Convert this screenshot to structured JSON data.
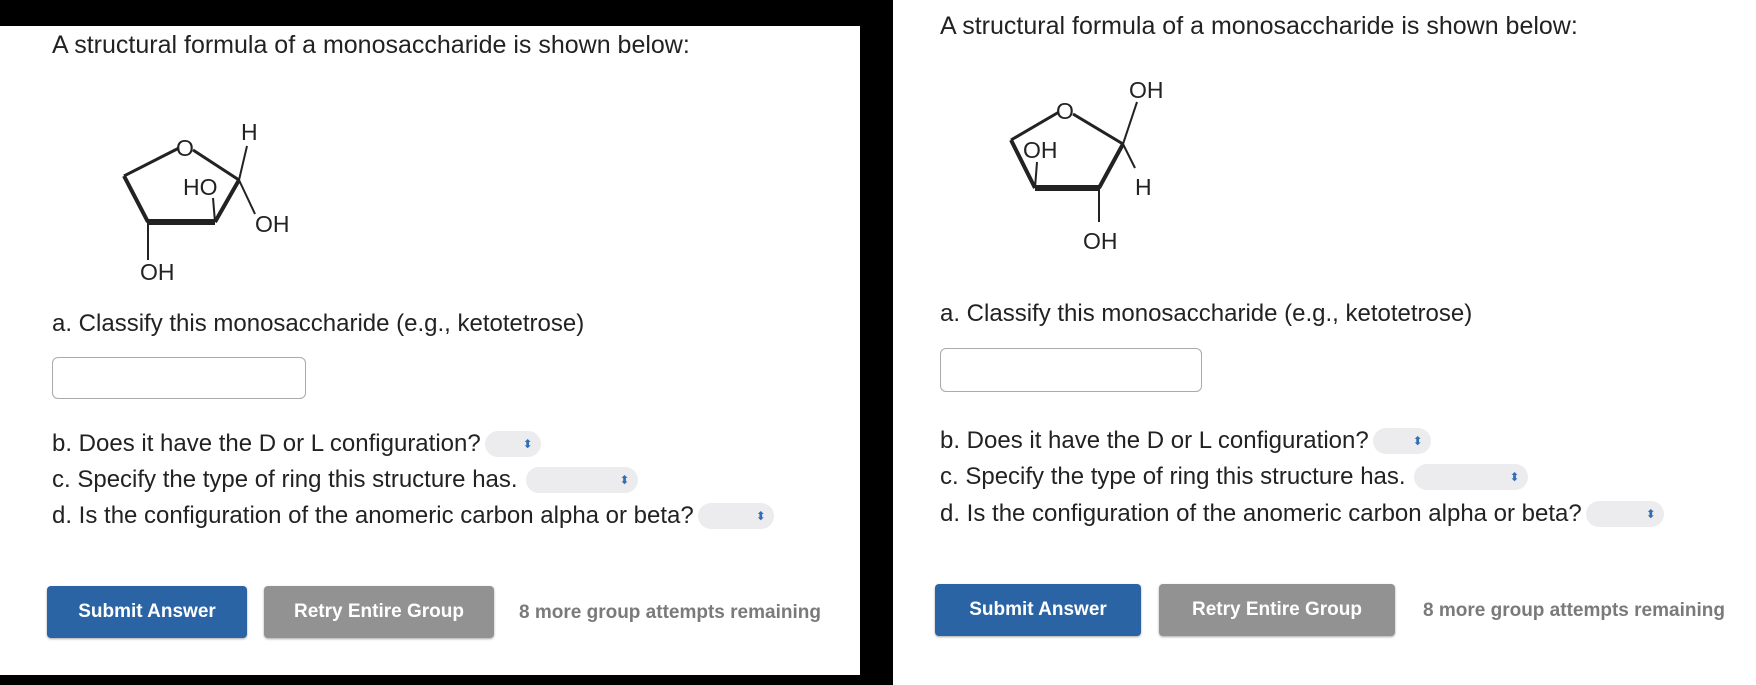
{
  "left_panel": {
    "prompt": "A structural formula of a monosaccharide is shown below:",
    "structure": {
      "labels": {
        "ring_o": "O",
        "top_h": "H",
        "ring_ho": "HO",
        "right_oh": "OH",
        "bottom_oh": "OH"
      }
    },
    "question_a": "a. Classify this monosaccharide (e.g., ketotetrose)",
    "answer_a_value": "",
    "question_b": "b. Does it have the D or L configuration?",
    "question_c": "c. Specify the type of ring this structure has.",
    "question_d": "d. Is the configuration of the anomeric carbon alpha or beta?",
    "select_b_value": "",
    "select_c_value": "",
    "select_d_value": "",
    "submit_label": "Submit Answer",
    "retry_label": "Retry Entire Group",
    "attempts_text": "8 more group attempts remaining"
  },
  "right_panel": {
    "prompt": "A structural formula of a monosaccharide is shown below:",
    "structure": {
      "labels": {
        "ring_o": "O",
        "top_oh": "OH",
        "ring_oh": "OH",
        "right_h": "H",
        "bottom_oh": "OH"
      }
    },
    "question_a": "a. Classify this monosaccharide (e.g., ketotetrose)",
    "answer_a_value": "",
    "question_b": "b. Does it have the D or L configuration?",
    "question_c": "c. Specify the type of ring this structure has.",
    "question_d": "d. Is the configuration of the anomeric carbon alpha or beta?",
    "select_b_value": "",
    "select_c_value": "",
    "select_d_value": "",
    "submit_label": "Submit Answer",
    "retry_label": "Retry Entire Group",
    "attempts_text": "8 more group attempts remaining"
  },
  "icons": {
    "select_chevron": "up-down-chevron-icon"
  },
  "colors": {
    "primary_button": "#2a64a4",
    "secondary_button": "#929292",
    "select_background": "#ececef",
    "chevron": "#2f6fb5"
  }
}
